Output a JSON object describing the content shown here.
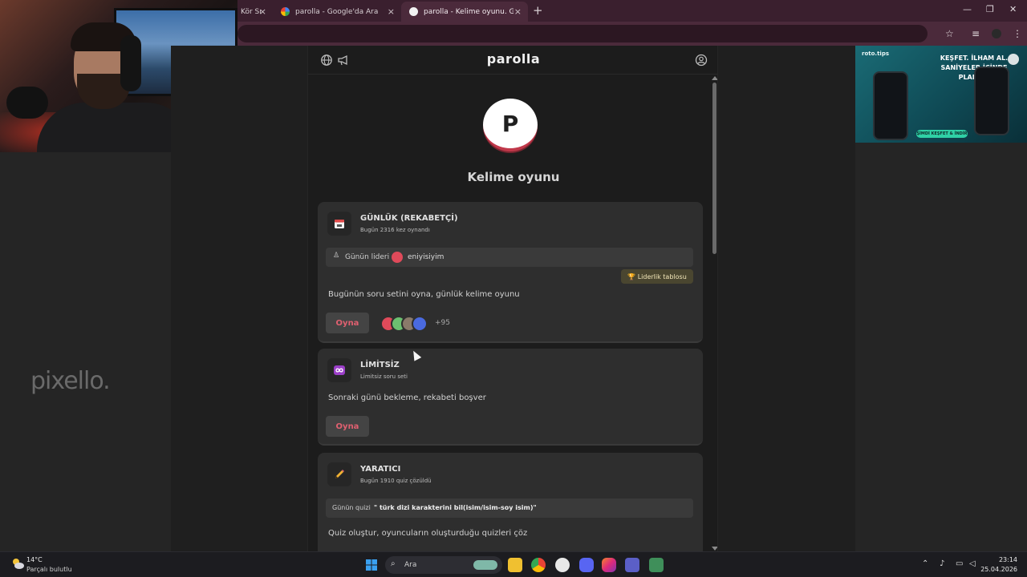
{
  "browser": {
    "tabs": [
      {
        "title": "Kör Sı",
        "active": false
      },
      {
        "title": "parolla - Google'da Ara",
        "active": false
      },
      {
        "title": "parolla - Kelime oyunu. Günlük",
        "active": true
      }
    ],
    "new_tab_symbol": "+",
    "close_symbol": "×"
  },
  "ad": {
    "brand": "roto.tips",
    "headline": "KEŞFET. İLHAM AL. SANİYELER İÇİNDE PLANLA!",
    "cta": "ŞİMDİ KEŞFET & İNDİR"
  },
  "watermark": "pixello.",
  "app": {
    "title": "parolla",
    "logo_letter": "P",
    "subtitle": "Kelime oyunu",
    "accent": "#e06070"
  },
  "cards": {
    "daily": {
      "icon": "calendar-icon",
      "title": "GÜNLÜK (REKABETÇİ)",
      "subtitle": "Bugün 2316 kez oynandı",
      "leader_label": "Günün lideri",
      "leader_name": "eniyisiyim",
      "leaderboard_button": "🏆 Liderlik tablosu",
      "description": "Bugünün soru setini oyna, günlük kelime oyunu",
      "play": "Oyna",
      "extra_players": "+95"
    },
    "unlimited": {
      "icon": "infinity-icon",
      "title": "LİMİTSİZ",
      "subtitle": "Limitsiz soru seti",
      "description": "Sonraki günü bekleme, rekabeti boşver",
      "play": "Oyna"
    },
    "creator": {
      "icon": "pencil-icon",
      "title": "YARATICI",
      "subtitle": "Bugün 1910 quiz çözüldü",
      "quiz_label": "Günün quizi",
      "quiz_text": "\" türk dizi karakterini bil(isim/isim-soy isim)\"",
      "description": "Quiz oluştur, oyuncuların oluşturduğu quizleri çöz"
    }
  },
  "taskbar": {
    "temperature": "14°C",
    "condition": "Parçalı bulutlu",
    "search": "Ara",
    "time": "23:14",
    "date": "25.04.2026"
  }
}
